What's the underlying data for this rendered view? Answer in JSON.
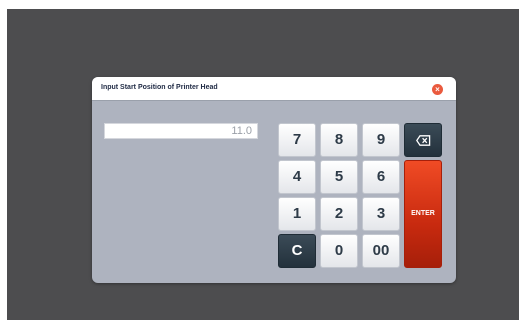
{
  "dialog": {
    "title": "Input Start Position of Printer Head",
    "close_icon": "close-icon"
  },
  "input": {
    "value": "11.0"
  },
  "keypad": {
    "k7": "7",
    "k8": "8",
    "k9": "9",
    "k4": "4",
    "k5": "5",
    "k6": "6",
    "k1": "1",
    "k2": "2",
    "k3": "3",
    "clear": "C",
    "k0": "0",
    "k00": "00",
    "backspace_icon": "backspace-icon",
    "enter": "ENTER"
  },
  "colors": {
    "background": "#4d4d4f",
    "dialog": "#aeb3bf",
    "enter": "#d83216",
    "dark_key": "#2c3a45",
    "close": "#ea5a3e"
  }
}
